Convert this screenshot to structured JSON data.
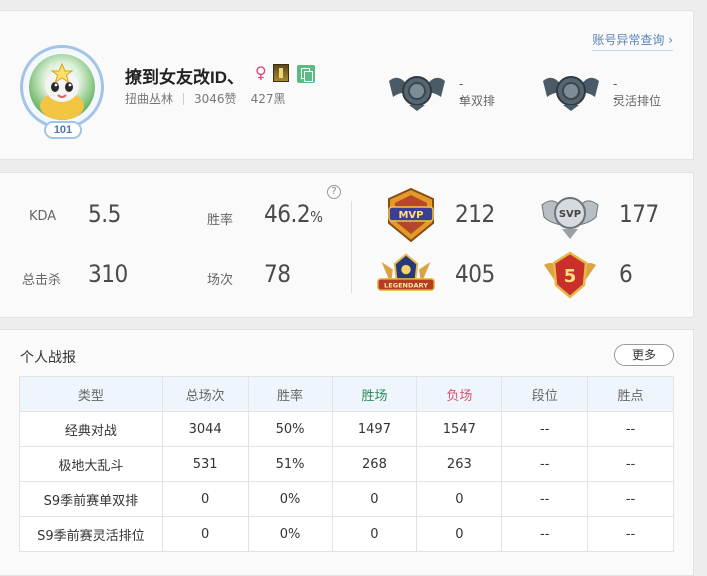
{
  "profile": {
    "abnormal_link": "账号异常查询 ›",
    "name": "撩到女友改ID、",
    "gender_symbol": "♀",
    "level": "101",
    "server": "扭曲丛林",
    "likes": "3046赞",
    "dislikes": "427黑",
    "solo_rank": {
      "value": "--",
      "label": "单双排"
    },
    "flex_rank": {
      "value": "--",
      "label": "灵活排位"
    }
  },
  "stats": {
    "kda_label": "KDA",
    "kda_value": "5.5",
    "winrate_label": "胜率",
    "winrate_value": "46.2",
    "winrate_unit": "%",
    "kills_label": "总击杀",
    "kills_value": "310",
    "games_label": "场次",
    "games_value": "78",
    "help_symbol": "?",
    "medals": [
      {
        "icon": "mvp-medal-icon",
        "label": "MVP",
        "count": "212"
      },
      {
        "icon": "svp-medal-icon",
        "label": "SVP",
        "count": "177"
      },
      {
        "icon": "legendary-medal-icon",
        "label": "LEGENDARY",
        "count": "405"
      },
      {
        "icon": "penta-kill-medal-icon",
        "label": "5",
        "count": "6"
      }
    ]
  },
  "report": {
    "title": "个人战报",
    "more_label": "更多",
    "columns": [
      "类型",
      "总场次",
      "胜率",
      "胜场",
      "负场",
      "段位",
      "胜点"
    ],
    "rows": [
      [
        "经典对战",
        "3044",
        "50%",
        "1497",
        "1547",
        "--",
        "--"
      ],
      [
        "极地大乱斗",
        "531",
        "51%",
        "268",
        "263",
        "--",
        "--"
      ],
      [
        "S9季前赛单双排",
        "0",
        "0%",
        "0",
        "0",
        "--",
        "--"
      ],
      [
        "S9季前赛灵活排位",
        "0",
        "0%",
        "0",
        "0",
        "--",
        "--"
      ]
    ]
  },
  "colors": {
    "win_header": "#2e8b57",
    "lose_header": "#e0506a",
    "link": "#5b84b6",
    "table_header_bg": "#eef5fd"
  }
}
